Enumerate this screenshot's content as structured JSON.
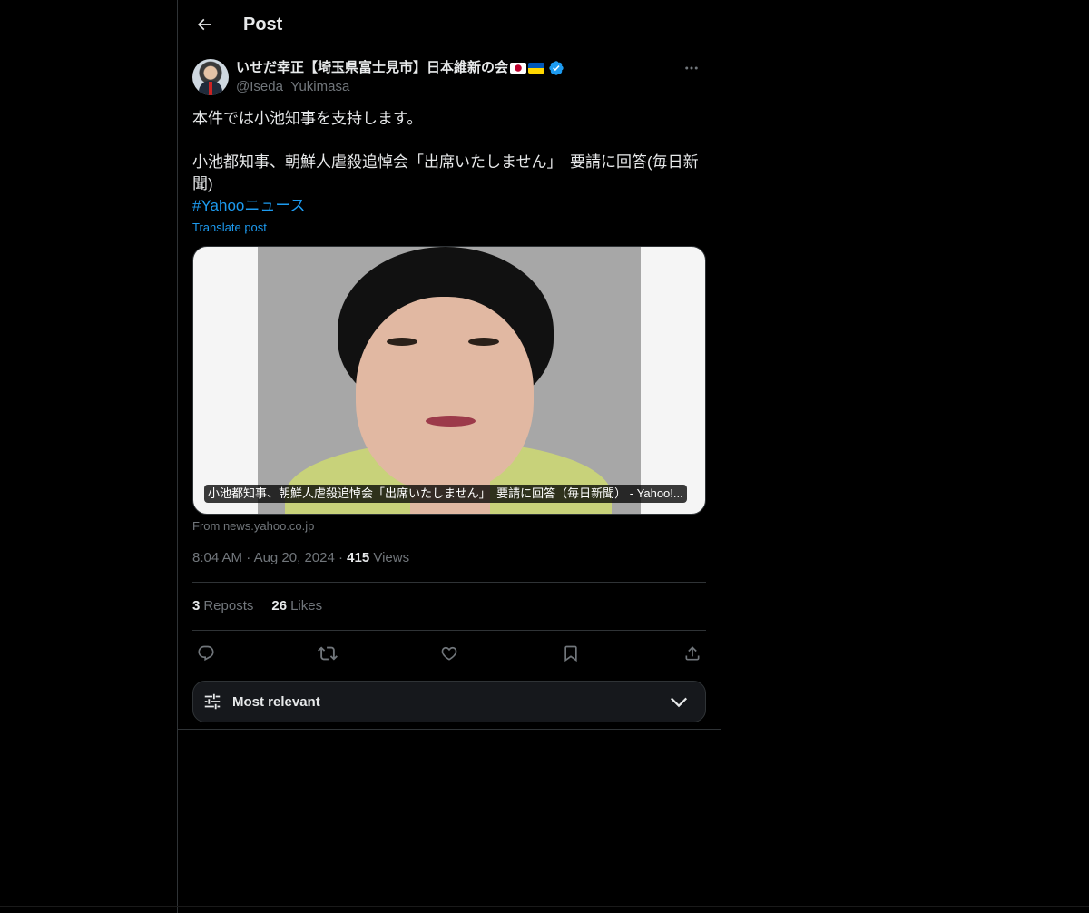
{
  "header": {
    "back_icon": "arrow-left-icon",
    "title": "Post"
  },
  "post": {
    "author": {
      "name": "いせだ幸正【埼玉県富士見市】日本維新の会",
      "flags": [
        "japan-flag-icon",
        "ukraine-flag-icon"
      ],
      "verified": true,
      "handle": "@Iseda_Yukimasa"
    },
    "text_line_1": "本件では小池知事を支持します。",
    "text_line_2": "小池都知事、朝鮮人虐殺追悼会「出席いたしません」　要請に回答(毎日新聞)",
    "hashtag": "#Yahooニュース",
    "translate_label": "Translate post",
    "card": {
      "caption": "小池都知事、朝鮮人虐殺追悼会「出席いたしません」　要請に回答（毎日新聞） - Yahoo!...",
      "source": "From news.yahoo.co.jp"
    },
    "time": "8:04 AM",
    "date": "Aug 20, 2024",
    "views_count": "415",
    "views_label": "Views",
    "reposts_count": "3",
    "reposts_label": "Reposts",
    "likes_count": "26",
    "likes_label": "Likes"
  },
  "actions": [
    "reply-icon",
    "repost-icon",
    "like-icon",
    "bookmark-icon",
    "share-icon"
  ],
  "sort": {
    "label": "Most relevant"
  },
  "colors": {
    "background": "#000000",
    "text": "#e7e9ea",
    "secondary": "#71767b",
    "accent": "#1d9bf0",
    "border": "#2f3336"
  }
}
